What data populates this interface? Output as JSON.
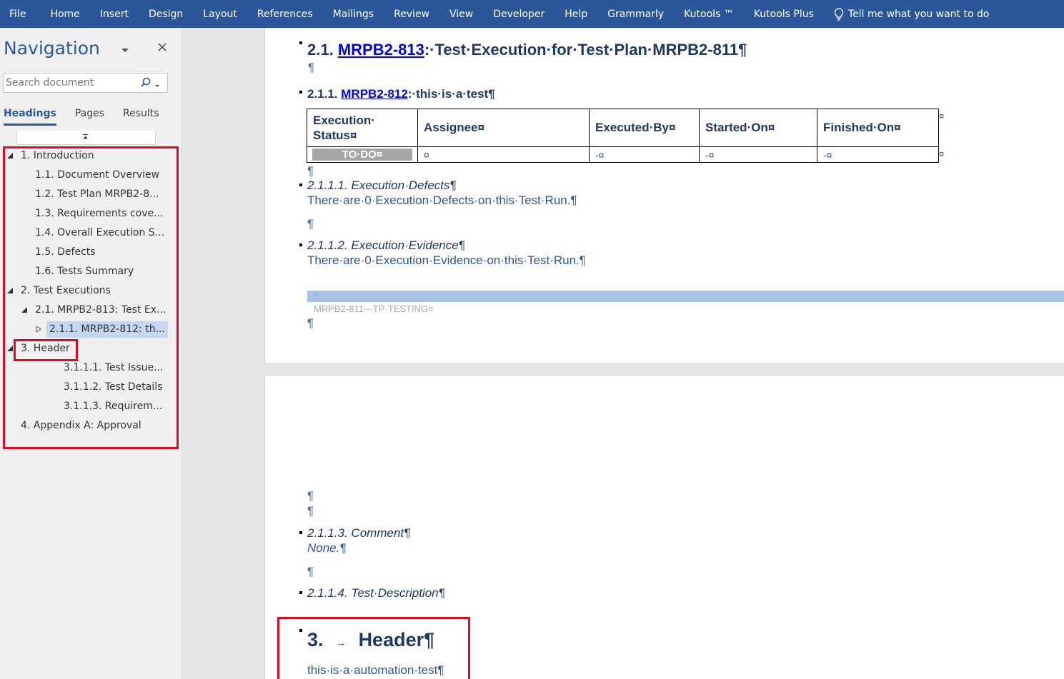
{
  "menubar": {
    "items": [
      "File",
      "Home",
      "Insert",
      "Design",
      "Layout",
      "References",
      "Mailings",
      "Review",
      "View",
      "Developer",
      "Help",
      "Grammarly",
      "Kutools ™",
      "Kutools Plus"
    ],
    "tell_me": "Tell me what you want to do"
  },
  "nav": {
    "title": "Navigation",
    "search_placeholder": "Search document",
    "tabs": [
      "Headings",
      "Pages",
      "Results"
    ],
    "tree": [
      {
        "label": "1. Introduction",
        "level": 1,
        "toggle": "expanded"
      },
      {
        "label": "1.1. Document Overview",
        "level": 2,
        "toggle": "none"
      },
      {
        "label": "1.2. Test Plan MRPB2-8...",
        "level": 2,
        "toggle": "none"
      },
      {
        "label": "1.3. Requirements cove...",
        "level": 2,
        "toggle": "none"
      },
      {
        "label": "1.4. Overall Execution S...",
        "level": 2,
        "toggle": "none"
      },
      {
        "label": "1.5. Defects",
        "level": 2,
        "toggle": "none"
      },
      {
        "label": "1.6. Tests Summary",
        "level": 2,
        "toggle": "none"
      },
      {
        "label": "2. Test Executions",
        "level": 1,
        "toggle": "expanded"
      },
      {
        "label": "2.1. MRPB2-813: Test Ex...",
        "level": 2,
        "toggle": "expanded"
      },
      {
        "label": "2.1.1. MRPB2-812: th...",
        "level": 3,
        "toggle": "collapsed",
        "selected": true
      },
      {
        "label": "3. Header",
        "level": 1,
        "toggle": "expanded"
      },
      {
        "label": "3.1.1.1. Test Issue...",
        "level": 4,
        "toggle": "none"
      },
      {
        "label": "3.1.1.2. Test Details",
        "level": 4,
        "toggle": "none"
      },
      {
        "label": "3.1.1.3. Requirem...",
        "level": 4,
        "toggle": "none"
      },
      {
        "label": "4. Appendix A: Approval",
        "level": 1,
        "toggle": "none"
      }
    ]
  },
  "doc": {
    "h2_num": "2.1. ",
    "h2_link": "MRPB2-813",
    "h2_rest": ":·Test·Execution·for·Test·Plan·MRPB2-811¶",
    "pilcrow": "¶",
    "h3_num": "2.1.1. ",
    "h3_link": "MRPB2-812",
    "h3_rest": ":·this·is·a·test¶",
    "table": {
      "headers": [
        "Execution·\nStatus¤",
        "Assignee¤",
        "Executed·By¤",
        "Started·On¤",
        "Finished·On¤"
      ],
      "row": [
        "TO·DO¤",
        "¤",
        "-¤",
        "-¤",
        "-¤"
      ],
      "end_mark": "¤"
    },
    "h4_defects": "2.1.1.1. Execution·Defects¶",
    "defects_text": "There·are·0·Execution·Defects·on·this·Test·Run.¶",
    "h4_evidence": "2.1.1.2. Execution·Evidence¶",
    "evidence_text": "There·are·0·Execution·Evidence·on·this·Test·Run.¶",
    "footer_bar_mark": "¤",
    "footer_text": "MRPB2-811·-·TP·TESTING¤",
    "h4_comment": "2.1.1.3. Comment¶",
    "comment_text": "None.¶",
    "h4_description": "2.1.1.4. Test·Description¶",
    "h1_num": "3.",
    "h1_tab": "→",
    "h1_text": "Header¶",
    "h1_body": "this·is·a·automation·test¶"
  },
  "colors": {
    "ribbon": "#2b579a",
    "heading": "#1f3864",
    "body_text": "#2e5597",
    "highlight_box": "#e00b1c",
    "selection": "#c5d7f0"
  }
}
